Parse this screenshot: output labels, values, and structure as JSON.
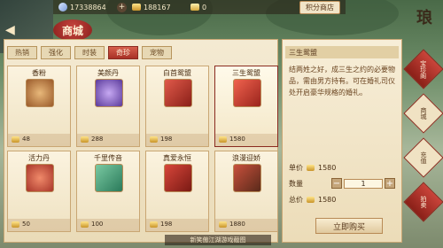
{
  "currencies": [
    {
      "icon": "gem-icon",
      "value": "17338864"
    },
    {
      "icon": "gold-ingot-icon",
      "value": "188167"
    },
    {
      "icon": "silver-ingot-icon",
      "value": "0"
    }
  ],
  "shop_button": "积分商店",
  "header_title": "商城",
  "tabs": [
    "热销",
    "强化",
    "时装",
    "奇珍",
    "宠物"
  ],
  "active_tab": "奇珍",
  "items": [
    {
      "name": "香粉",
      "price": "48"
    },
    {
      "name": "美颜丹",
      "price": "288"
    },
    {
      "name": "白首鸳盟",
      "price": "198"
    },
    {
      "name": "三生鸳盟",
      "price": "1580"
    },
    {
      "name": "活力丹",
      "price": "50"
    },
    {
      "name": "千里传音",
      "price": "100"
    },
    {
      "name": "真爱永恒",
      "price": "198"
    },
    {
      "name": "浪漫迎娇",
      "price": "1880"
    }
  ],
  "detail": {
    "title": "三生鸳盟",
    "description": "结两姓之好，成三生之约的必要物品，需由男方持有。可在婚礼司仪处开启豪华规格的婚礼。",
    "unit_price_label": "单价",
    "unit_price": "1580",
    "quantity_label": "数量",
    "quantity": "1",
    "total_label": "总价",
    "total": "1580",
    "buy_label": "立即购买"
  },
  "side_menu": {
    "title": "琅",
    "items": [
      "宝珍阁",
      "商城",
      "充值",
      "拍卖"
    ]
  },
  "watermark": "新笑傲江湖游戏截图"
}
